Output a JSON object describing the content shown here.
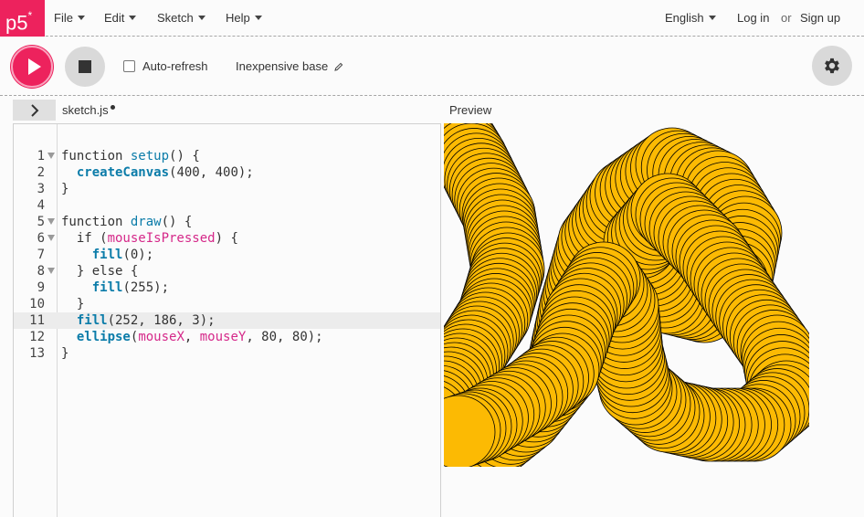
{
  "nav": {
    "logo": "p5",
    "logo_sup": "*",
    "menu": [
      "File",
      "Edit",
      "Sketch",
      "Help"
    ],
    "language": "English",
    "login": "Log in",
    "or": "or",
    "signup": "Sign up"
  },
  "toolbar": {
    "auto_refresh_label": "Auto-refresh",
    "auto_refresh_checked": false,
    "sketch_name": "Inexpensive base"
  },
  "editor": {
    "file_tab": "sketch.js",
    "unsaved": true,
    "active_line": 11,
    "lines": [
      "function setup() {",
      "  createCanvas(400, 400);",
      "}",
      "",
      "function draw() {",
      "  if (mouseIsPressed) {",
      "    fill(0);",
      "  } else {",
      "    fill(255);",
      "  }",
      "  fill(252, 186, 3);",
      "  ellipse(mouseX, mouseY, 80, 80);",
      "}"
    ],
    "fold_lines": [
      1,
      5,
      6,
      8
    ]
  },
  "preview": {
    "label": "Preview",
    "ellipse_fill": "#fcba03",
    "ellipse_stroke": "#000000",
    "ellipse_diameter": 80
  },
  "colors": {
    "accent": "#ed225d",
    "button_grey": "#d9d9d9"
  }
}
